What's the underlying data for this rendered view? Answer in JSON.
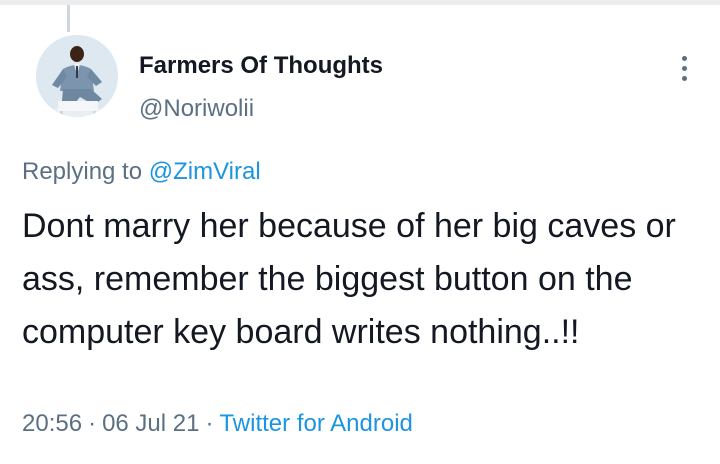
{
  "tweet": {
    "author_name": "Farmers Of Thoughts",
    "author_handle": "@Noriwolii",
    "replying_prefix": "Replying to ",
    "replying_mention": "@ZimViral",
    "text": "Dont marry her because of her big caves or ass, remember the biggest button on the computer key board writes nothing..!!",
    "time": "20:56",
    "separator": "·",
    "date": "06 Jul 21",
    "client": "Twitter for Android"
  },
  "icons": {
    "more": "more-options-icon",
    "avatar": "profile-photo"
  },
  "colors": {
    "text_primary": "#141823",
    "text_secondary": "#5b7083",
    "link": "#1b95e0",
    "background": "#ffffff"
  }
}
